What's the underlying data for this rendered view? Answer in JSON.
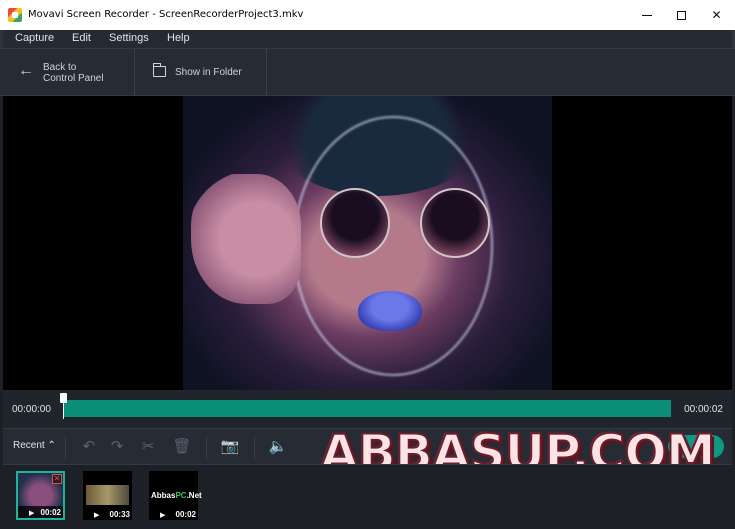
{
  "window": {
    "title": "Movavi Screen Recorder - ScreenRecorderProject3.mkv",
    "controls": {
      "minimize": "–",
      "maximize": "□",
      "close": "✕"
    }
  },
  "menu": [
    "Capture",
    "Edit",
    "Settings",
    "Help"
  ],
  "toolbar": {
    "back_label": "Back to\nControl Panel",
    "folder_label": "Show in Folder"
  },
  "timeline": {
    "start_time": "00:00:00",
    "end_time": "00:00:02",
    "playhead_progress": 0.0
  },
  "controls": {
    "recent_label": "Recent",
    "icons": [
      "undo-icon",
      "redo-icon",
      "cut-icon",
      "delete-icon",
      "camera-icon",
      "volume-icon"
    ]
  },
  "watermark": "ABBASUP.COM",
  "recent_items": [
    {
      "duration": "00:02"
    },
    {
      "duration": "00:33"
    },
    {
      "duration": "00:02",
      "logo_text": "Abbas",
      "logo_accent": "PC",
      "logo_suffix": ".Net"
    }
  ],
  "colors": {
    "accent": "#0b8f76",
    "toggle": "#0e9a80",
    "selection": "#1db49a"
  }
}
